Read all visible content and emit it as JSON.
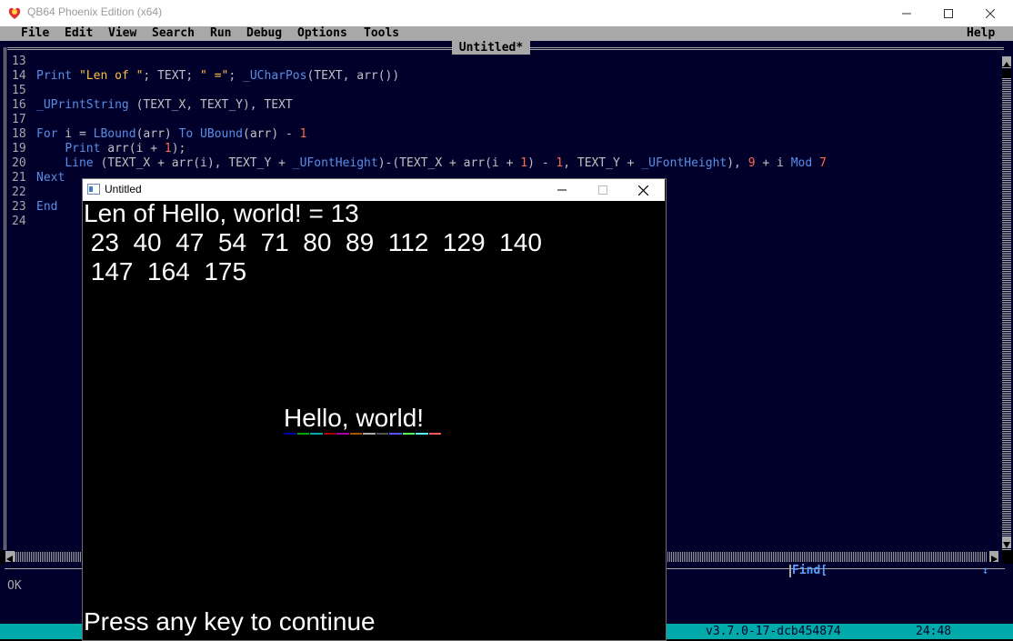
{
  "window": {
    "title": "QB64 Phoenix Edition (x64)"
  },
  "menu": {
    "items": [
      "File",
      "Edit",
      "View",
      "Search",
      "Run",
      "Debug",
      "Options",
      "Tools"
    ],
    "help": "Help"
  },
  "editor": {
    "tab_title": "Untitled*",
    "line_numbers": [
      "13",
      "14",
      "15",
      "16",
      "17",
      "18",
      "19",
      "20",
      "21",
      "22",
      "23",
      "24"
    ],
    "lines": {
      "l14": {
        "kw1": "Print",
        "str1": "\"Len of \"",
        "t1": "; TEXT; ",
        "str2": "\" =\"",
        "t2": "; ",
        "kw2": "_UCharPos",
        "t3": "(TEXT, arr())"
      },
      "l16": {
        "kw1": "_UPrintString",
        "t1": " (TEXT_X, TEXT_Y), TEXT"
      },
      "l18": {
        "kw1": "For",
        "t1": " i = ",
        "kw2": "LBound",
        "t2": "(arr) ",
        "kw3": "To",
        "t3": " ",
        "kw4": "UBound",
        "t4": "(arr) - ",
        "n1": "1"
      },
      "l19": {
        "indent": "    ",
        "kw1": "Print",
        "t1": " arr(i + ",
        "n1": "1",
        "t2": ");"
      },
      "l20": {
        "indent": "    ",
        "kw1": "Line",
        "t1": " (TEXT_X + arr(i), TEXT_Y + ",
        "kw2": "_UFontHeight",
        "t2": ")-(TEXT_X + arr(i + ",
        "n1": "1",
        "t3": ") - ",
        "n2": "1",
        "t4": ", TEXT_Y + ",
        "kw3": "_UFontHeight",
        "t5": "), ",
        "n3": "9",
        "t6": " + i ",
        "kw4": "Mod",
        "t7": " ",
        "n4": "7"
      },
      "l21": {
        "kw1": "Next"
      },
      "l23": {
        "kw1": "End"
      }
    }
  },
  "status": {
    "message": "OK",
    "find_label": "Find[",
    "find_arrow": "↕",
    "version": "v3.7.0-17-dcb454874",
    "cursor": "24:48"
  },
  "output_window": {
    "title": "Untitled",
    "line1": "Len of Hello, world! = 13",
    "line2": " 23  40  47  54  71  80  89  112  129  140",
    "line3": " 147  164  175",
    "centered_text": "Hello, world!",
    "underline_colors": [
      "#0000aa",
      "#00aa00",
      "#00aaaa",
      "#aa0000",
      "#aa00aa",
      "#aa5500",
      "#aaaaaa",
      "#555555",
      "#5555ff",
      "#55ff55",
      "#55ffff",
      "#ff5555"
    ],
    "footer": "Press any key to continue"
  },
  "colors": {
    "editor_bg": "#00002a",
    "keyword": "#5a8ee6",
    "string": "#ffc040",
    "number": "#ff6b4a",
    "menu_bg": "#a8a8a8",
    "statusbar": "#00aaaa"
  }
}
